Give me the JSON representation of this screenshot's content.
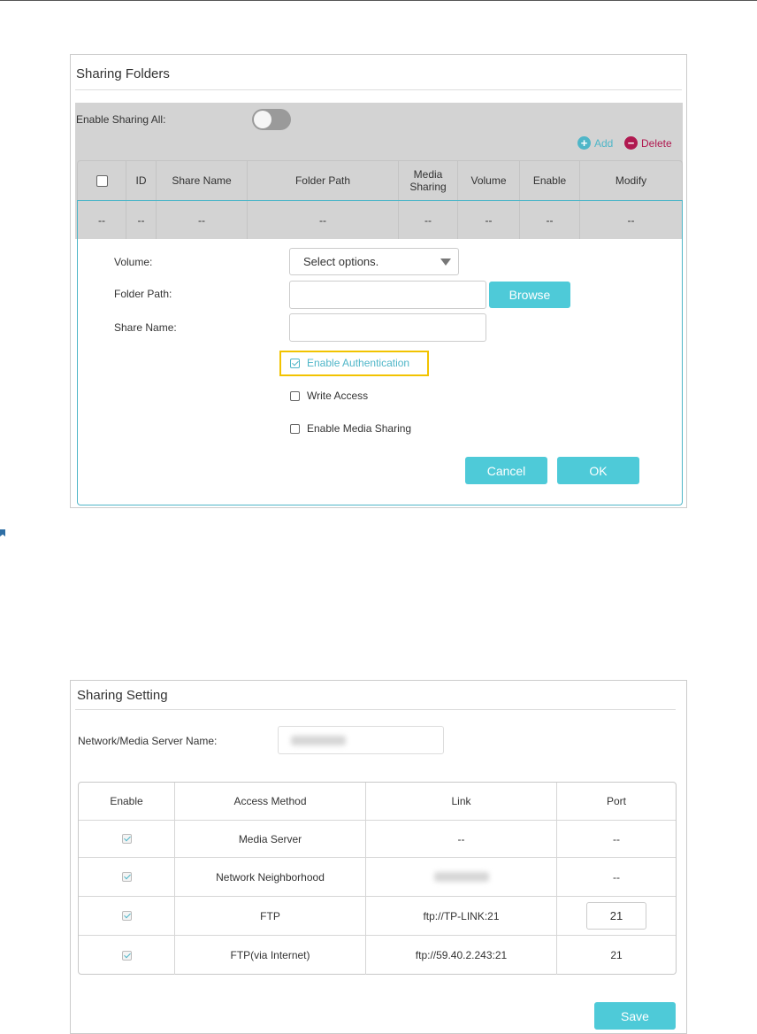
{
  "sharing_folders": {
    "title": "Sharing Folders",
    "enable_sharing_all_label": "Enable Sharing All:",
    "enable_sharing_all_on": false,
    "add_label": "Add",
    "delete_label": "Delete",
    "columns": [
      "ID",
      "Share Name",
      "Folder Path",
      "Media Sharing",
      "Volume",
      "Enable",
      "Modify"
    ],
    "row": [
      "--",
      "--",
      "--",
      "--",
      "--",
      "--",
      "--",
      "--"
    ],
    "form": {
      "volume_label": "Volume:",
      "volume_value": "Select options.",
      "folder_path_label": "Folder Path:",
      "browse_label": "Browse",
      "share_name_label": "Share Name:",
      "enable_auth_label": "Enable Authentication",
      "enable_auth_checked": true,
      "write_access_label": "Write Access",
      "write_access_checked": false,
      "media_sharing_label": "Enable Media Sharing",
      "media_sharing_checked": false,
      "cancel_label": "Cancel",
      "ok_label": "OK"
    }
  },
  "sharing_setting": {
    "title": "Sharing Setting",
    "server_name_label": "Network/Media Server Name:",
    "columns": [
      "Enable",
      "Access Method",
      "Link",
      "Port"
    ],
    "rows": [
      {
        "method": "Media Server",
        "link": "--",
        "port": "--",
        "enabled": true
      },
      {
        "method": "Network Neighborhood",
        "link": "",
        "port": "--",
        "enabled": true
      },
      {
        "method": "FTP",
        "link": "ftp://TP-LINK:21",
        "port": "21",
        "enabled": true
      },
      {
        "method": "FTP(via Internet)",
        "link": "ftp://59.40.2.243:21",
        "port": "21",
        "enabled": true
      }
    ],
    "save_label": "Save"
  },
  "colors": {
    "accent": "#4ecad8",
    "delete": "#b01950",
    "highlight": "#f2c300"
  }
}
